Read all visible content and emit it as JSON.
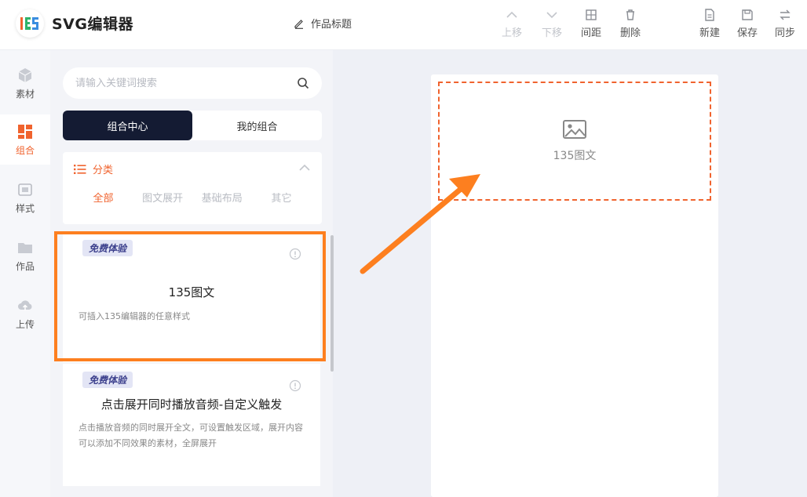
{
  "header": {
    "app_title": "SVG编辑器",
    "work_title": "作品标题",
    "tools": [
      {
        "label": "上移",
        "icon": "arrow-up-icon",
        "disabled": true
      },
      {
        "label": "下移",
        "icon": "arrow-down-icon",
        "disabled": true
      },
      {
        "label": "间距",
        "icon": "spacing-icon",
        "disabled": false
      },
      {
        "label": "删除",
        "icon": "trash-icon",
        "disabled": false
      },
      {
        "label": "新建",
        "icon": "new-file-icon",
        "disabled": false
      },
      {
        "label": "保存",
        "icon": "save-icon",
        "disabled": false
      },
      {
        "label": "同步",
        "icon": "sync-icon",
        "disabled": false
      }
    ]
  },
  "rail": {
    "items": [
      {
        "label": "素材",
        "icon": "cube-icon",
        "active": false
      },
      {
        "label": "组合",
        "icon": "layout-blocks-icon",
        "active": true
      },
      {
        "label": "样式",
        "icon": "image-frame-icon",
        "active": false
      },
      {
        "label": "作品",
        "icon": "folder-icon",
        "active": false
      },
      {
        "label": "上传",
        "icon": "cloud-upload-icon",
        "active": false
      }
    ]
  },
  "panel": {
    "search_placeholder": "请输入关键词搜索",
    "segments": [
      "组合中心",
      "我的组合"
    ],
    "active_segment": 0,
    "category": {
      "label": "分类",
      "tabs": [
        "全部",
        "图文展开",
        "基础布局",
        "其它"
      ],
      "active_tab": 0
    },
    "cards": [
      {
        "badge": "免费体验",
        "title": "135图文",
        "desc": "可插入135编辑器的任意样式"
      },
      {
        "badge": "免费体验",
        "title": "点击展开同时播放音频-自定义触发",
        "desc": "点击播放音频的同时展开全文，可设置触发区域，展开内容可以添加不同效果的素材，全屏展开"
      }
    ]
  },
  "canvas": {
    "placeholder_label": "135图文"
  },
  "colors": {
    "accent": "#f0632e",
    "highlight": "#fd7f1f",
    "dark": "#141b33"
  }
}
